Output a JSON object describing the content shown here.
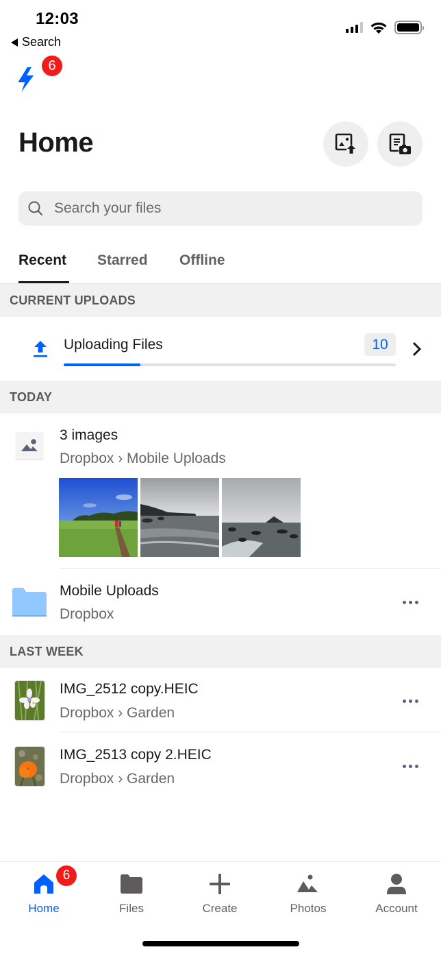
{
  "status_bar": {
    "time": "12:03",
    "back_label": "Search",
    "signal_bars": 3,
    "signal_bars_total": 4,
    "battery_level": 1.0
  },
  "activity": {
    "icon": "bolt-icon",
    "badge_count": "6"
  },
  "header": {
    "title": "Home",
    "upload_photo_button": "upload-photo-icon",
    "scan_document_button": "scan-document-icon"
  },
  "search": {
    "placeholder": "Search your files"
  },
  "tabs": [
    {
      "label": "Recent",
      "active": true
    },
    {
      "label": "Starred",
      "active": false
    },
    {
      "label": "Offline",
      "active": false
    }
  ],
  "sections": {
    "current_uploads": "CURRENT UPLOADS",
    "today": "TODAY",
    "last_week": "LAST WEEK"
  },
  "upload": {
    "title": "Uploading Files",
    "count": "10",
    "progress": 0.23
  },
  "today_items": [
    {
      "title": "3 images",
      "path": "Dropbox › Mobile Uploads",
      "icon": "image-icon",
      "thumbnails": [
        "meadow-path-photo",
        "rocky-coast-photo",
        "sea-rocks-island-photo"
      ]
    },
    {
      "title": "Mobile Uploads",
      "path": "Dropbox",
      "icon": "folder-icon"
    }
  ],
  "last_week_items": [
    {
      "title": "IMG_2512 copy.HEIC",
      "path": "Dropbox › Garden",
      "thumbnail": "white-flower-photo"
    },
    {
      "title": "IMG_2513 copy 2.HEIC",
      "path": "Dropbox › Garden",
      "thumbnail": "orange-poppy-photo"
    }
  ],
  "tab_bar": {
    "items": [
      {
        "label": "Home",
        "icon": "home-icon",
        "active": true
      },
      {
        "label": "Files",
        "icon": "folder-icon",
        "active": false
      },
      {
        "label": "Create",
        "icon": "plus-icon",
        "active": false
      },
      {
        "label": "Photos",
        "icon": "photos-icon",
        "active": false
      },
      {
        "label": "Account",
        "icon": "person-icon",
        "active": false
      }
    ],
    "home_badge": "6"
  },
  "colors": {
    "accent": "#0061fe",
    "badge": "#f01c1c",
    "folder": "#90c8ff",
    "section_bg": "#f2f1f1"
  }
}
